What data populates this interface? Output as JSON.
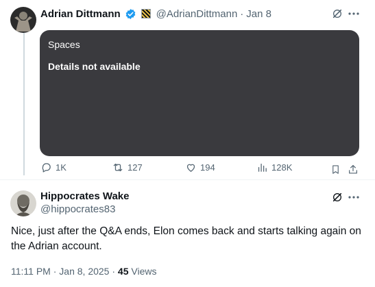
{
  "post": {
    "author_name": "Adrian Dittmann",
    "handle": "@AdrianDittmann",
    "separator": "·",
    "date": "Jan 8",
    "card": {
      "title": "Spaces",
      "detail": "Details not available"
    },
    "actions": {
      "replies": "1K",
      "reposts": "127",
      "likes": "194",
      "views": "128K"
    }
  },
  "reply": {
    "author_name": "Hippocrates Wake",
    "handle": "@hippocrates83",
    "text": "Nice, just after the Q&A ends, Elon comes back and starts talking again on the Adrian account.",
    "timestamp": "11:11 PM · Jan 8, 2025 · ",
    "views_count": "45",
    "views_label": " Views"
  },
  "icons": {
    "verified": "verified-badge-icon",
    "grok": "grok-icon",
    "more": "more-icon",
    "reply": "reply-icon",
    "repost": "repost-icon",
    "like": "like-icon",
    "views": "views-icon",
    "bookmark": "bookmark-icon",
    "share": "share-icon"
  },
  "colors": {
    "verified_blue": "#1d9bf0",
    "muted": "#536471",
    "card_bg": "#3a3a3e"
  }
}
